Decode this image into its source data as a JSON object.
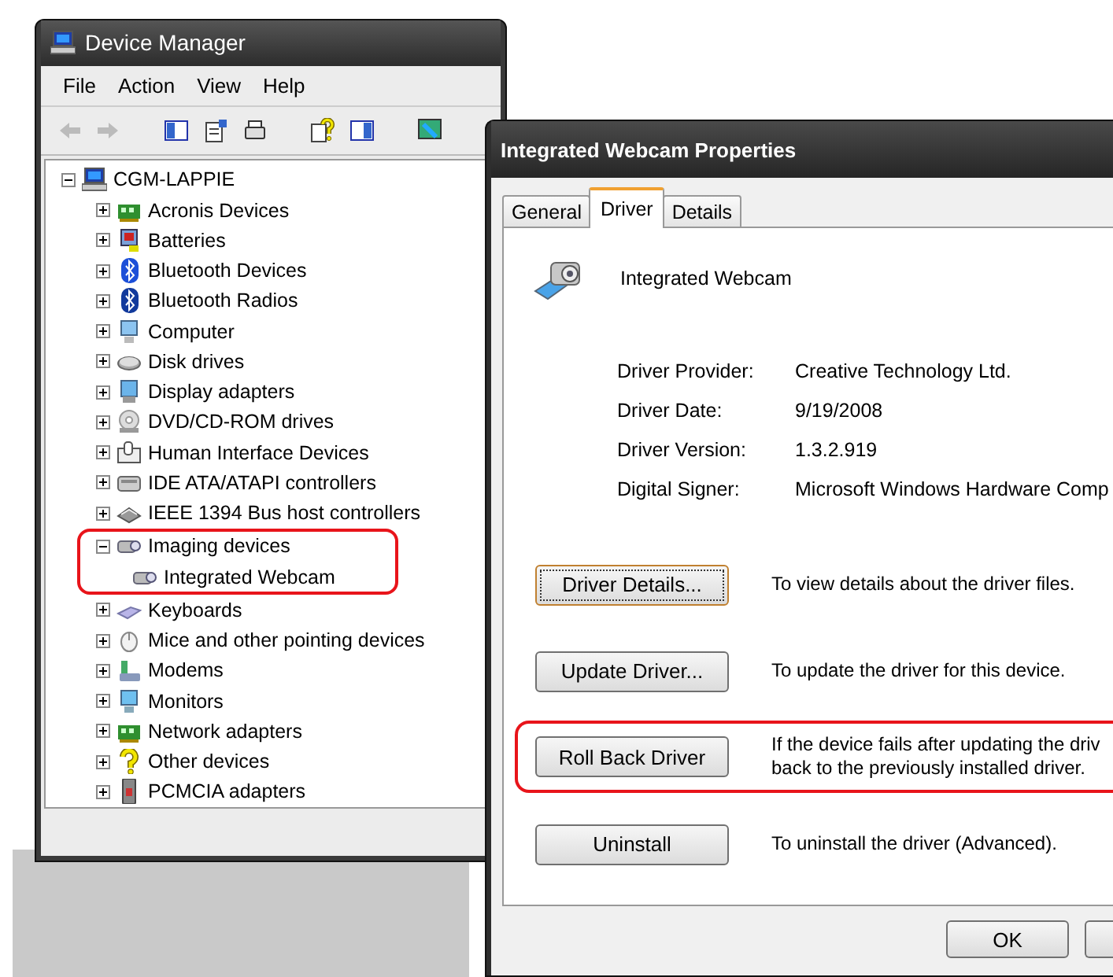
{
  "device_manager": {
    "title": "Device Manager",
    "menu": [
      "File",
      "Action",
      "View",
      "Help"
    ],
    "tree": {
      "label": "CGM-LAPPIE",
      "expanded": true,
      "children": [
        {
          "label": "Acronis Devices",
          "expanded": false,
          "highlighted": false
        },
        {
          "label": "Batteries",
          "expanded": false,
          "highlighted": false
        },
        {
          "label": "Bluetooth Devices",
          "expanded": false,
          "highlighted": false
        },
        {
          "label": "Bluetooth Radios",
          "expanded": false,
          "highlighted": false
        },
        {
          "label": "Computer",
          "expanded": false,
          "highlighted": false
        },
        {
          "label": "Disk drives",
          "expanded": false,
          "highlighted": false
        },
        {
          "label": "Display adapters",
          "expanded": false,
          "highlighted": false
        },
        {
          "label": "DVD/CD-ROM drives",
          "expanded": false,
          "highlighted": false
        },
        {
          "label": "Human Interface Devices",
          "expanded": false,
          "highlighted": false
        },
        {
          "label": "IDE ATA/ATAPI controllers",
          "expanded": false,
          "highlighted": false
        },
        {
          "label": "IEEE 1394 Bus host controllers",
          "expanded": false,
          "highlighted": false
        },
        {
          "label": "Imaging devices",
          "expanded": true,
          "highlighted": true,
          "children": [
            {
              "label": "Integrated Webcam"
            }
          ]
        },
        {
          "label": "Keyboards",
          "expanded": false,
          "highlighted": false
        },
        {
          "label": "Mice and other pointing devices",
          "expanded": false,
          "highlighted": false
        },
        {
          "label": "Modems",
          "expanded": false,
          "highlighted": false
        },
        {
          "label": "Monitors",
          "expanded": false,
          "highlighted": false
        },
        {
          "label": "Network adapters",
          "expanded": false,
          "highlighted": false
        },
        {
          "label": "Other devices",
          "expanded": false,
          "highlighted": false
        },
        {
          "label": "PCMCIA adapters",
          "expanded": false,
          "highlighted": false
        }
      ]
    }
  },
  "properties": {
    "title": "Integrated Webcam Properties",
    "tabs": [
      {
        "label": "General",
        "selected": false
      },
      {
        "label": "Driver",
        "selected": true
      },
      {
        "label": "Details",
        "selected": false
      }
    ],
    "device_name": "Integrated Webcam",
    "fields": [
      {
        "label": "Driver Provider:",
        "value": "Creative Technology Ltd."
      },
      {
        "label": "Driver Date:",
        "value": "9/19/2008"
      },
      {
        "label": "Driver Version:",
        "value": "1.3.2.919"
      },
      {
        "label": "Digital Signer:",
        "value": "Microsoft Windows Hardware Comp"
      }
    ],
    "actions": [
      {
        "button": "Driver Details...",
        "description": "To view details about the driver files.",
        "focused": true,
        "highlighted": false
      },
      {
        "button": "Update Driver...",
        "description": "To update the driver for this device.",
        "focused": false,
        "highlighted": false
      },
      {
        "button": "Roll Back Driver",
        "description": "If the device fails after updating the driv\nback to the previously installed driver.",
        "focused": false,
        "highlighted": true
      },
      {
        "button": "Uninstall",
        "description": "To uninstall the driver (Advanced).",
        "focused": false,
        "highlighted": false
      }
    ],
    "ok_button": "OK"
  }
}
